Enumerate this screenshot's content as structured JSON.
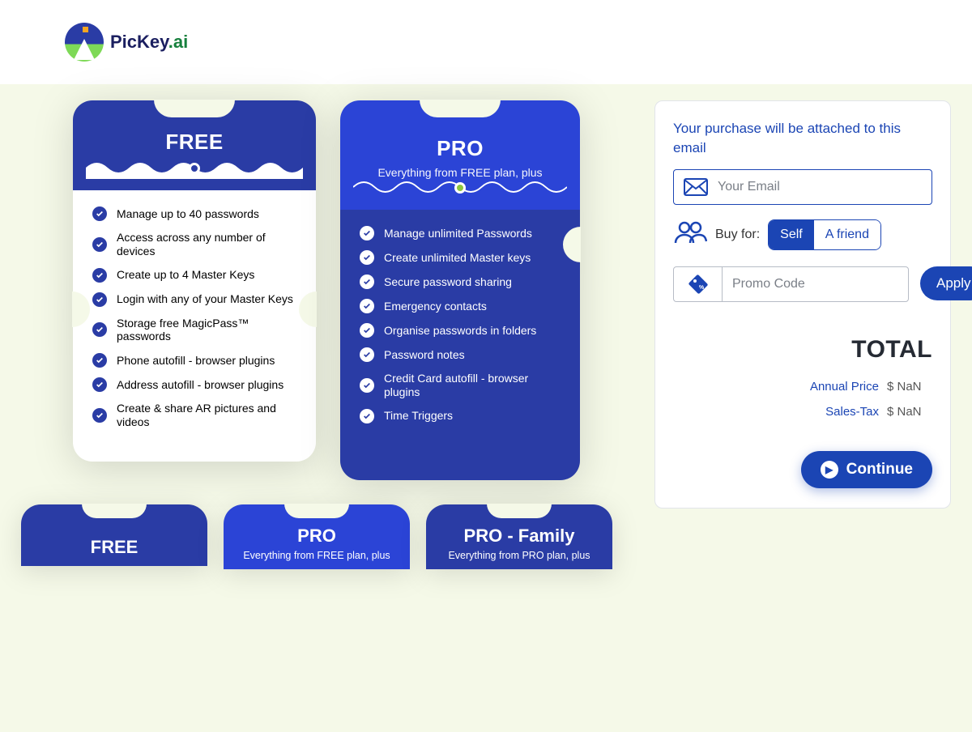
{
  "brand": {
    "name": "PicKey",
    "suffix": ".ai"
  },
  "plans": {
    "free": {
      "title": "FREE",
      "features": [
        "Manage up to 40 passwords",
        "Access across any number of devices",
        "Create up to 4 Master Keys",
        "Login with any of your Master Keys",
        "Storage free MagicPass™ passwords",
        "Phone autofill - browser plugins",
        "Address autofill - browser plugins",
        "Create & share AR pictures and videos"
      ]
    },
    "pro": {
      "title": "PRO",
      "subtitle": "Everything from FREE plan, plus",
      "features": [
        "Manage unlimited Passwords",
        "Create unlimited Master keys",
        "Secure password sharing",
        "Emergency contacts",
        "Organise passwords in folders",
        "Password notes",
        "Credit Card autofill - browser plugins",
        "Time Triggers"
      ]
    }
  },
  "mini": {
    "free": {
      "title": "FREE"
    },
    "pro": {
      "title": "PRO",
      "subtitle": "Everything from FREE plan, plus"
    },
    "profam": {
      "title": "PRO - Family",
      "subtitle": "Everything from PRO plan, plus"
    }
  },
  "checkout": {
    "hint": "Your purchase will be attached to this email",
    "email_placeholder": "Your Email",
    "buy_for_label": "Buy for:",
    "option_self": "Self",
    "option_friend": "A friend",
    "promo_placeholder": "Promo Code",
    "apply_label": "Apply",
    "total_heading": "TOTAL",
    "rows": {
      "annual_label": "Annual Price",
      "annual_value": "$ NaN",
      "tax_label": "Sales-Tax",
      "tax_value": "$ NaN"
    },
    "continue_label": "Continue"
  }
}
